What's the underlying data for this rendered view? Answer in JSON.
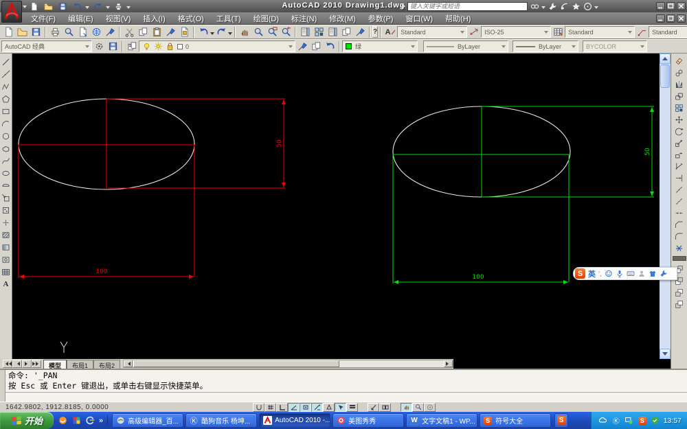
{
  "window": {
    "title": "AutoCAD 2010  Drawing1.dwg",
    "search_placeholder": "键入关键字或短语"
  },
  "menu": {
    "items": [
      "文件(F)",
      "编辑(E)",
      "视图(V)",
      "插入(I)",
      "格式(O)",
      "工具(T)",
      "绘图(D)",
      "标注(N)",
      "修改(M)",
      "参数(P)",
      "窗口(W)",
      "帮助(H)"
    ]
  },
  "glyphs": {
    "help": "?",
    "mtext": "A",
    "text_style": "A",
    "sogou": "S",
    "kugou": "Ⓚ",
    "wps": "W",
    "ime_mark": "’,",
    "quick_launch_more": "»"
  },
  "toolbar_standard_icons": [
    "qnew",
    "open",
    "save",
    "plot",
    "plot-preview",
    "publish",
    "web",
    "page-edit",
    "cut",
    "copy",
    "paste",
    "match-properties",
    "block-editor",
    "undo",
    "redo",
    "pan-realtime",
    "zoom-realtime",
    "zoom-window",
    "zoom-previous",
    "properties",
    "designcenter",
    "tool-palettes",
    "sheetset-manager",
    "markup",
    "help"
  ],
  "toolbar_styles": {
    "text_style": "Standard",
    "dim_style": "ISO-25",
    "table_style": "Standard",
    "mleader_style": "Standard"
  },
  "toolbar_workspace": {
    "value": "AutoCAD 经典"
  },
  "toolbar_layers": {
    "layer_name": "0"
  },
  "toolbar_properties": {
    "color_label": "绿",
    "color_hex": "#00dd00",
    "linetype": "ByLayer",
    "lineweight": "ByLayer",
    "plot_style": "BYCOLOR"
  },
  "draw_toolbar_icons": [
    "line",
    "construction-line",
    "polyline",
    "polygon",
    "rectangle",
    "arc",
    "circle",
    "revision-cloud",
    "spline",
    "ellipse",
    "ellipse-arc",
    "insert-block",
    "make-block",
    "point",
    "hatch",
    "gradient",
    "region",
    "table",
    "multiline-text"
  ],
  "modify_toolbar_icons": [
    "erase",
    "copy",
    "mirror",
    "offset",
    "array",
    "move",
    "rotate",
    "scale",
    "stretch",
    "trim",
    "extend",
    "break-at-point",
    "break",
    "join",
    "chamfer",
    "fillet",
    "explode",
    "bring-to-front",
    "send-to-back",
    "bring-above-objects",
    "send-under-objects"
  ],
  "canvas": {
    "background": "#000000",
    "ellipse_color": "#e8e8e8",
    "left_figure": {
      "color": "#f00000",
      "width_dim": "100",
      "height_dim": "50"
    },
    "right_figure": {
      "color": "#00dd00",
      "width_dim": "100",
      "height_dim": "50"
    }
  },
  "layout_tabs": {
    "tabs": [
      "模型",
      "布局1",
      "布局2"
    ],
    "active_tab": "模型"
  },
  "command_window": {
    "history": [
      "命令: '_PAN",
      "按 Esc 或 Enter 键退出，或单击右键显示快捷菜单。"
    ]
  },
  "status_bar": {
    "coordinates": "1642.9802, 1912.8185, 0.0000"
  },
  "ime_bar": {
    "mode": "英"
  },
  "taskbar": {
    "start_label": "开始",
    "tasks": [
      {
        "label": "高级编辑器_百..."
      },
      {
        "label": "酷狗音乐 杨坤..."
      },
      {
        "label": "AutoCAD 2010 -..."
      },
      {
        "label": "美图秀秀"
      },
      {
        "label": "文字文稿1 - WP..."
      },
      {
        "label": "符号大全"
      }
    ],
    "tray_time": "13:57"
  }
}
